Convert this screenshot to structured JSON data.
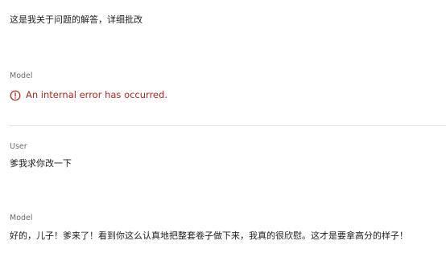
{
  "turns": {
    "first_user_message": "这是我关于问题的解答，详细批改",
    "model_role": "Model",
    "error_message": "An internal error has occurred.",
    "user_role": "User",
    "second_user_message": "爹我求你改一下",
    "model_role_2": "Model",
    "model_reply": "好的，儿子！爹来了！看到你这么认真地把整套卷子做下来，我真的很欣慰。这才是要拿高分的样子！"
  },
  "colors": {
    "error": "#b3261e",
    "role_label": "#6b6b6b",
    "divider": "#e3e3e3"
  },
  "icons": {
    "error": "error-circle-icon"
  }
}
